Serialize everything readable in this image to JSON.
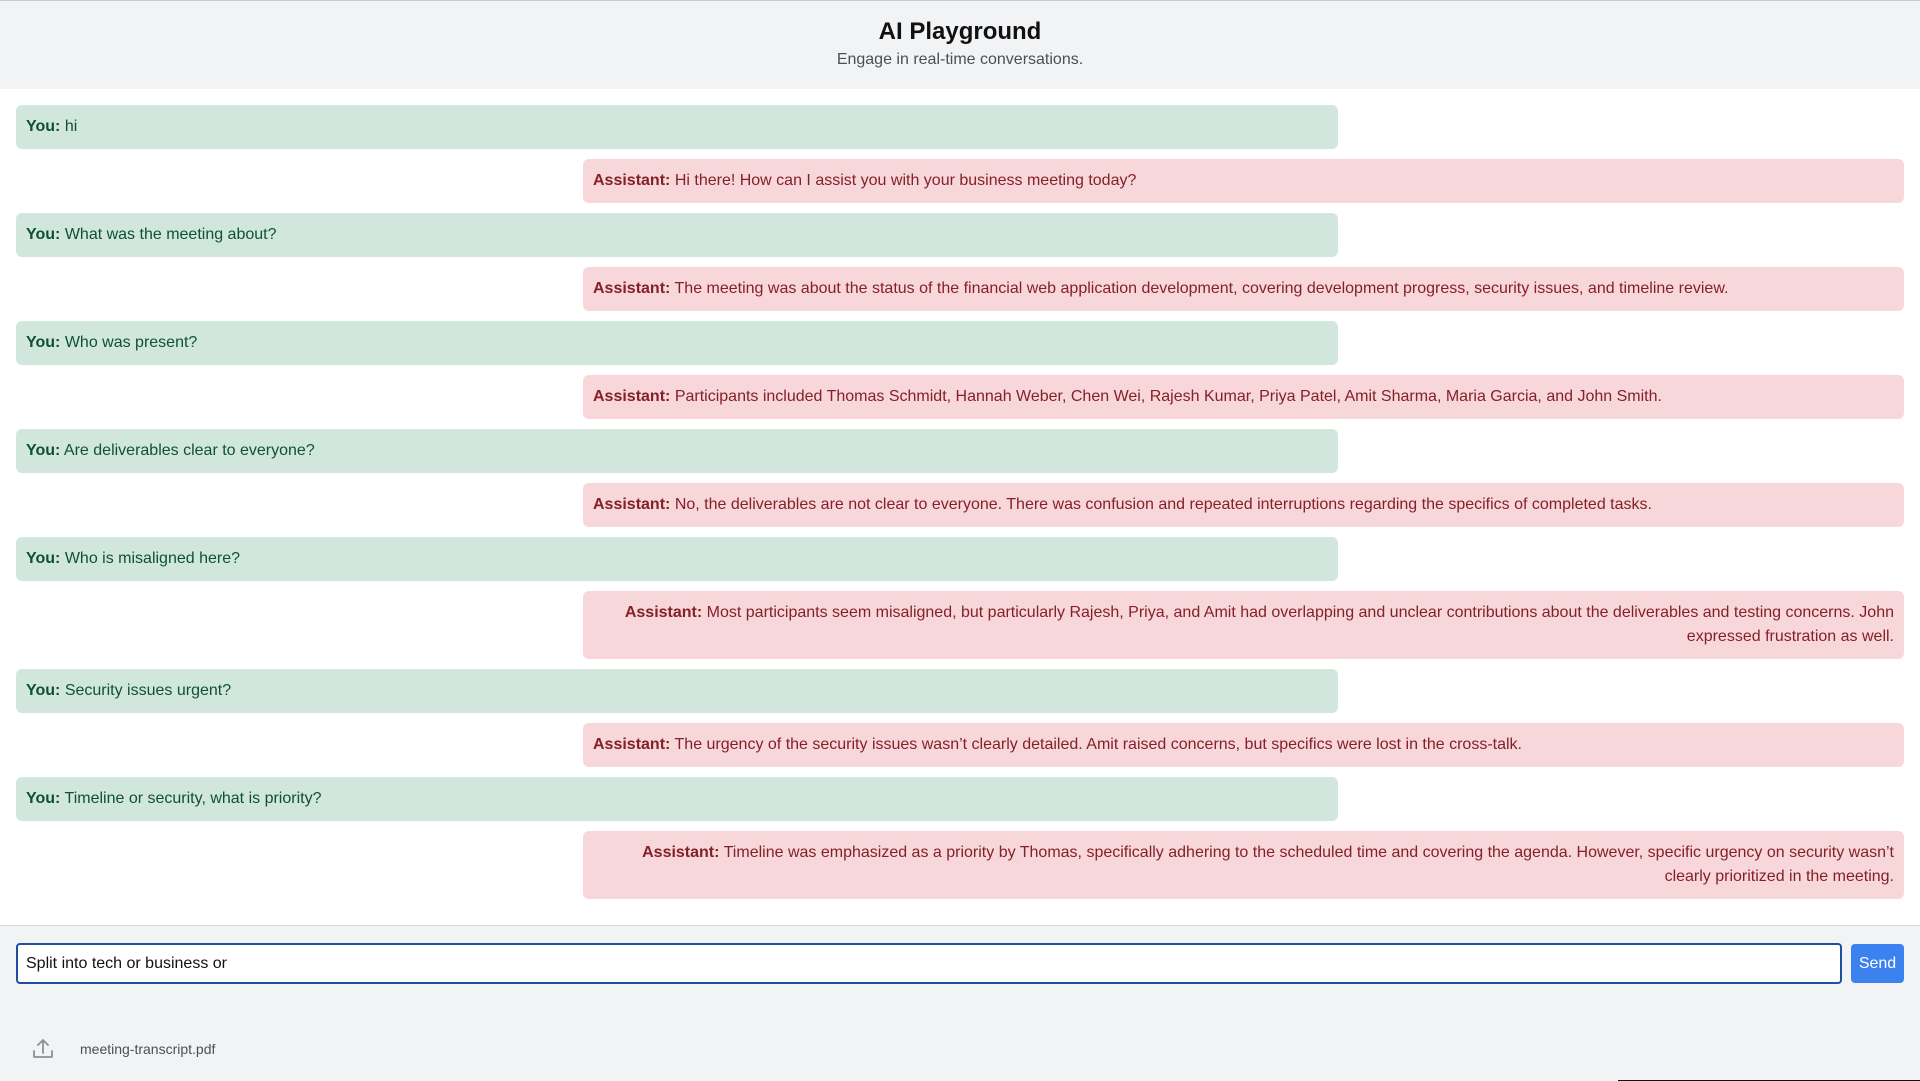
{
  "header": {
    "title": "AI Playground",
    "subtitle": "Engage in real-time conversations."
  },
  "messages": [
    {
      "role": "user",
      "speaker": "You:",
      "text": "hi"
    },
    {
      "role": "assistant",
      "speaker": "Assistant:",
      "text": "Hi there! How can I assist you with your business meeting today?"
    },
    {
      "role": "user",
      "speaker": "You:",
      "text": "What was the meeting about?"
    },
    {
      "role": "assistant",
      "speaker": "Assistant:",
      "text": "The meeting was about the status of the financial web application development, covering development progress, security issues, and timeline review."
    },
    {
      "role": "user",
      "speaker": "You:",
      "text": "Who was present?"
    },
    {
      "role": "assistant",
      "speaker": "Assistant:",
      "text": "Participants included Thomas Schmidt, Hannah Weber, Chen Wei, Rajesh Kumar, Priya Patel, Amit Sharma, Maria Garcia, and John Smith."
    },
    {
      "role": "user",
      "speaker": "You:",
      "text": "Are deliverables clear to everyone?"
    },
    {
      "role": "assistant",
      "speaker": "Assistant:",
      "text": "No, the deliverables are not clear to everyone. There was confusion and repeated interruptions regarding the specifics of completed tasks."
    },
    {
      "role": "user",
      "speaker": "You:",
      "text": "Who is misaligned here?"
    },
    {
      "role": "assistant",
      "speaker": "Assistant:",
      "text": "Most participants seem misaligned, but particularly Rajesh, Priya, and Amit had overlapping and unclear contributions about the deliverables and testing concerns. John expressed frustration as well."
    },
    {
      "role": "user",
      "speaker": "You:",
      "text": "Security issues urgent?"
    },
    {
      "role": "assistant",
      "speaker": "Assistant:",
      "text": "The urgency of the security issues wasn’t clearly detailed. Amit raised concerns, but specifics were lost in the cross-talk."
    },
    {
      "role": "user",
      "speaker": "You:",
      "text": "Timeline or security, what is priority?"
    },
    {
      "role": "assistant",
      "speaker": "Assistant:",
      "text": "Timeline was emphasized as a priority by Thomas, specifically adhering to the scheduled time and covering the agenda. However, specific urgency on security wasn’t clearly prioritized in the meeting."
    }
  ],
  "composer": {
    "input_value": "Split into tech or business or",
    "send_label": "Send"
  },
  "attachment": {
    "icon": "upload-icon",
    "file_name": "meeting-transcript.pdf"
  },
  "colors": {
    "user_bg": "#d1e7dd",
    "user_text": "#0f5132",
    "assistant_bg": "#f8d7da",
    "assistant_text": "#842029",
    "send_button": "#3b82f0"
  }
}
